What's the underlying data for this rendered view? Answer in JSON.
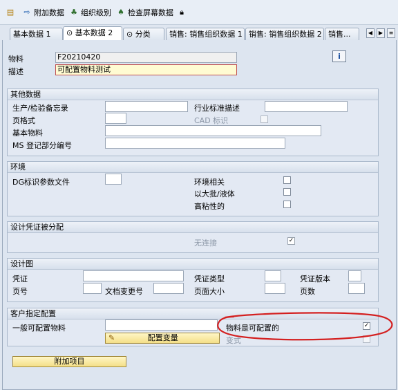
{
  "toolbar": {
    "additional_data": "附加数据",
    "org_levels": "组织级别",
    "check_screen_data": "检查屏幕数据"
  },
  "tabs": [
    {
      "label": "基本数据 1"
    },
    {
      "label": "基本数据 2"
    },
    {
      "label": "分类"
    },
    {
      "label": "销售: 销售组织数据 1"
    },
    {
      "label": "销售: 销售组织数据 2"
    },
    {
      "label": "销售..."
    }
  ],
  "header": {
    "material_label": "物料",
    "material_value": "F20210420",
    "description_label": "描述",
    "description_value": "可配置物料测试",
    "info_button": "i"
  },
  "other_data": {
    "title": "其他数据",
    "prod_memo_label": "生产/检验备忘录",
    "industry_desc_label": "行业标准描述",
    "page_format_label": "页格式",
    "cad_label": "CAD 标识",
    "basic_material_label": "基本物料",
    "ms_book_label": "MS 登记部分编号"
  },
  "environment": {
    "title": "环境",
    "dg_label": "DG标识参数文件",
    "env_relevant_label": "环境相关",
    "bulk_label": "以大批/液体",
    "high_viscous_label": "高粘性的"
  },
  "design_docs": {
    "title": "设计凭证被分配",
    "no_link_label": "无连接"
  },
  "design_drawing": {
    "title": "设计图",
    "document_label": "凭证",
    "doc_type_label": "凭证类型",
    "doc_version_label": "凭证版本",
    "page_no_label": "页号",
    "doc_change_label": "文档变更号",
    "page_size_label": "页面大小",
    "pages_label": "页数"
  },
  "client_config": {
    "title": "客户指定配置",
    "general_config_label": "一般可配置物料",
    "configurable_label": "物料是可配置的",
    "config_variant_button": "配置变量",
    "variant_label": "变式"
  },
  "bottom": {
    "additional_item_button": "附加项目"
  },
  "colors": {
    "annotation": "#d42020",
    "button_yellow": "#f4df88"
  }
}
